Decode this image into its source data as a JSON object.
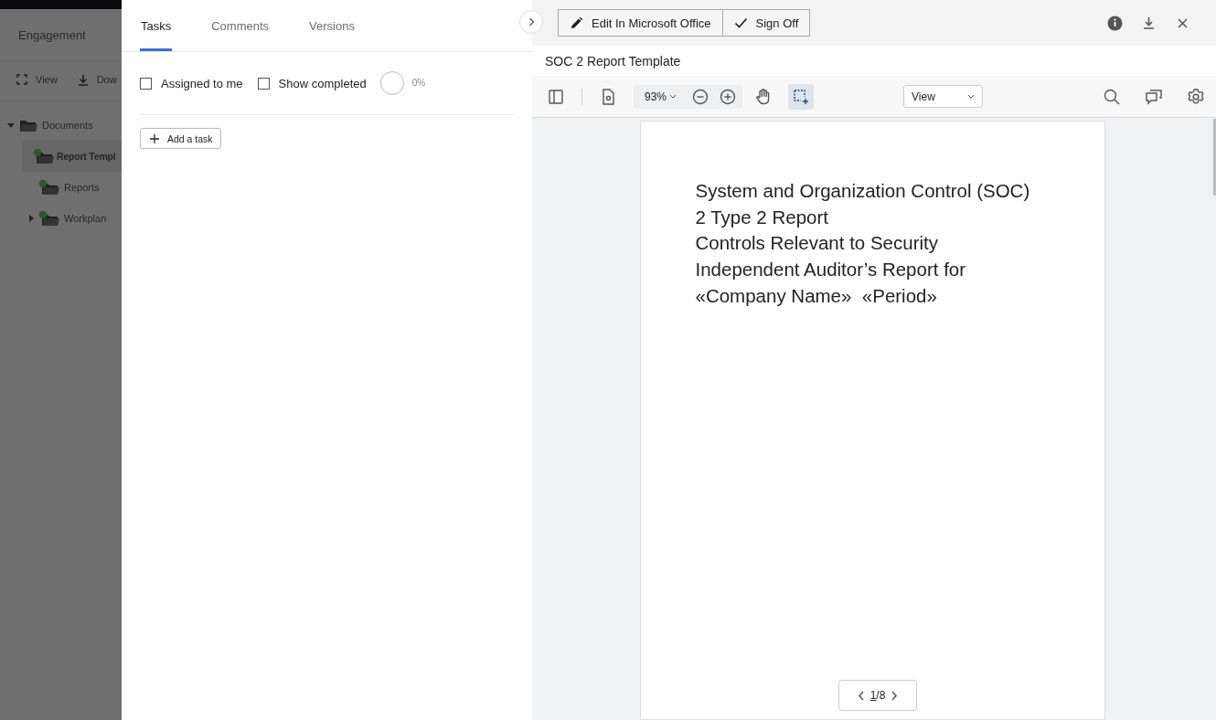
{
  "sidebar": {
    "title": "Engagement",
    "toolbar": [
      {
        "kind": "view",
        "label": "View"
      },
      {
        "kind": "download",
        "label": "Dow"
      }
    ],
    "tree": [
      {
        "label": "Documents",
        "expanded": true,
        "selected": false,
        "children": [
          {
            "label": "Report Templ",
            "selected": true
          },
          {
            "label": "Reports",
            "selected": false
          },
          {
            "label": "Workplan",
            "selected": false,
            "expanded": false
          }
        ]
      }
    ]
  },
  "task_panel": {
    "tabs": [
      {
        "label": "Tasks",
        "selected": true
      },
      {
        "label": "Comments",
        "selected": false
      },
      {
        "label": "Versions",
        "selected": false
      }
    ],
    "filters": [
      {
        "label": "Assigned to me",
        "checked": false
      },
      {
        "label": "Show completed",
        "checked": false
      }
    ],
    "progress": {
      "level": 0,
      "reading": "0%"
    },
    "add_button": "Add a task"
  },
  "viewer": {
    "actions": [
      {
        "kind": "edit",
        "label": "Edit In Microsoft Office"
      },
      {
        "kind": "check",
        "label": "Sign Off"
      }
    ],
    "title": "SOC 2 Report Template",
    "zoom": "93%",
    "mode": "View",
    "document_lines": [
      "System and Organization Control (SOC)",
      "2 Type 2 Report",
      "Controls Relevant to Security",
      "Independent Auditor’s Report for",
      "«Company Name»  «Period»"
    ],
    "page": {
      "current": "1",
      "total": "/8"
    }
  }
}
